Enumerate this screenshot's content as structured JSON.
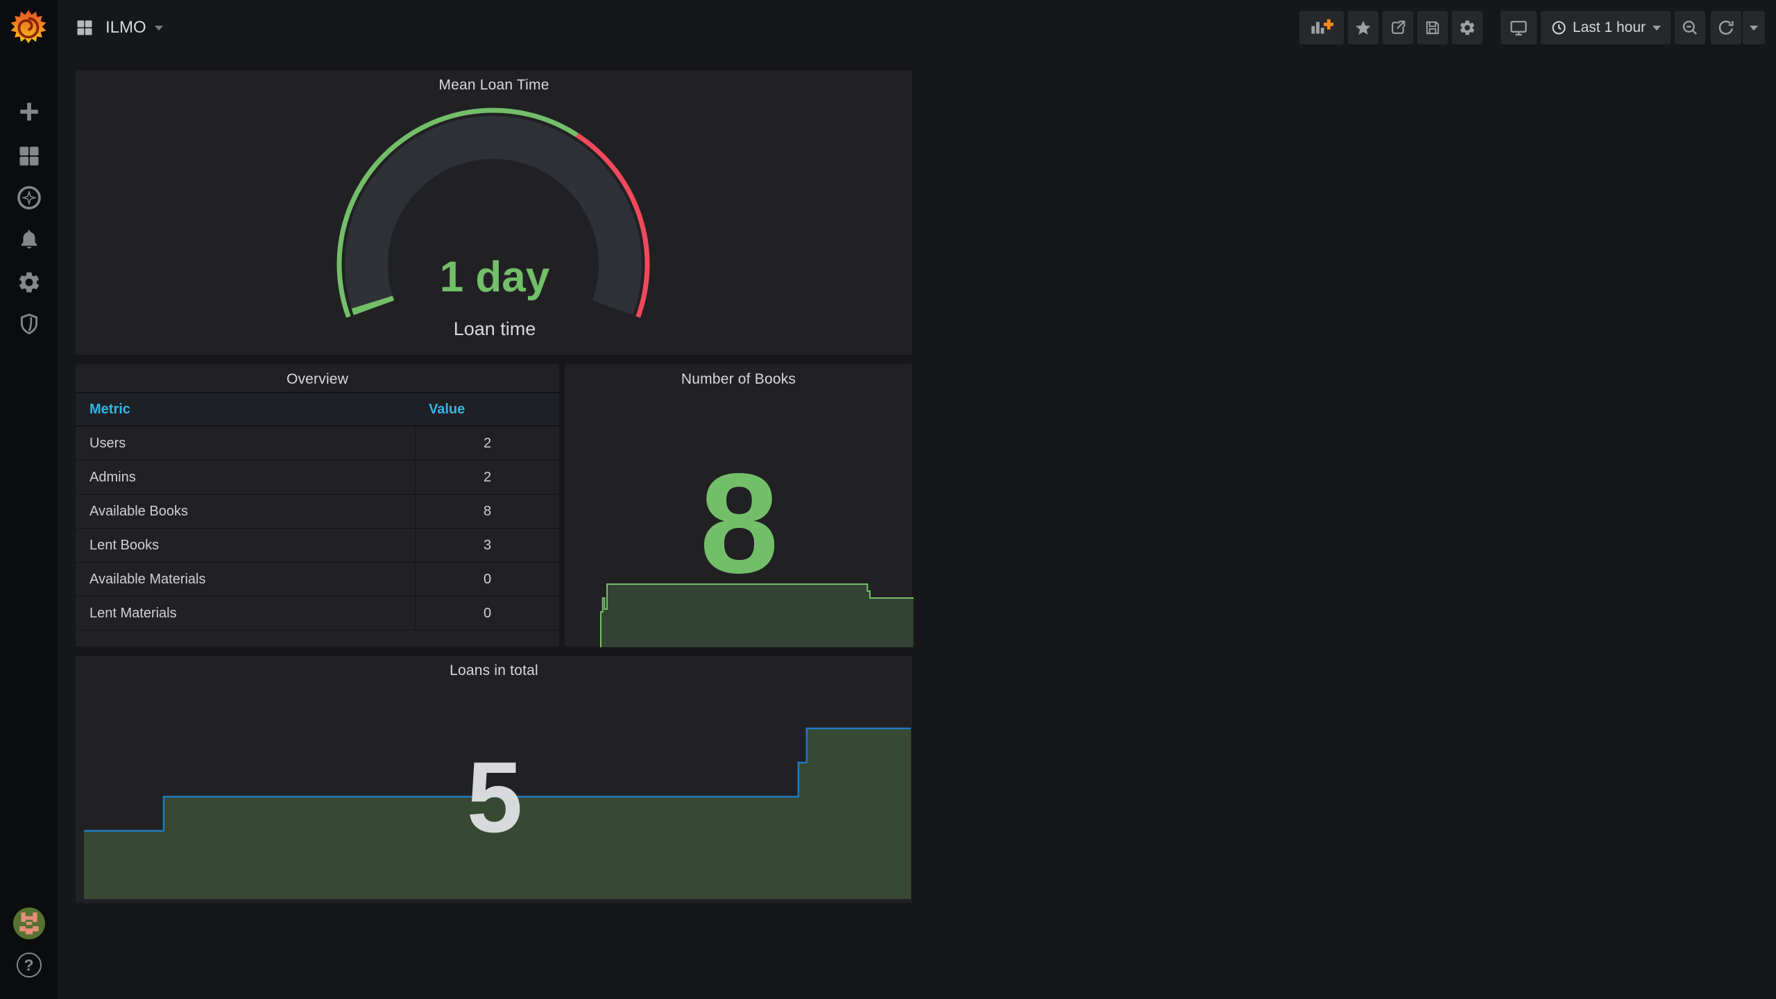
{
  "navbar": {
    "dashboard_title": "ILMO",
    "time_range": "Last 1 hour",
    "actions": [
      "add-panel",
      "star",
      "share",
      "save",
      "settings",
      "cycle-view",
      "time-picker",
      "zoom-out",
      "refresh",
      "refresh-interval"
    ]
  },
  "sidebar": {
    "items": [
      "create",
      "dashboards",
      "explore",
      "alerting",
      "configuration",
      "server-admin"
    ],
    "bottom": [
      "user-avatar",
      "help"
    ]
  },
  "colors": {
    "green": "#73bf69",
    "red": "#f2495c",
    "header_blue": "#33b5e5",
    "line_blue": "#1f78c1",
    "panel_bg": "#212124",
    "page_bg": "#161719"
  },
  "chart_data": [
    {
      "type": "gauge",
      "title": "Mean Loan Time",
      "value_text": "1 day",
      "label": "Loan time",
      "percent": 0.012,
      "threshold_split": 0.65,
      "colors": {
        "fill": "#73bf69",
        "ok": "#73bf69",
        "alert": "#f2495c",
        "track": "#2e3136"
      }
    },
    {
      "type": "table",
      "title": "Overview",
      "headers": [
        "Metric",
        "Value"
      ],
      "rows": [
        [
          "Users",
          "2"
        ],
        [
          "Admins",
          "2"
        ],
        [
          "Available Books",
          "8"
        ],
        [
          "Lent Books",
          "3"
        ],
        [
          "Available Materials",
          "0"
        ],
        [
          "Lent Materials",
          "0"
        ]
      ]
    },
    {
      "type": "area",
      "title": "Number of Books",
      "big_value": "8",
      "steps": [
        [
          0,
          6
        ],
        [
          0.006,
          7
        ],
        [
          0.012,
          6.2
        ],
        [
          0.02,
          8
        ],
        [
          0.845,
          8
        ],
        [
          0.852,
          7.5
        ],
        [
          0.86,
          7
        ],
        [
          1,
          7
        ]
      ],
      "vmin": 6,
      "vmax": 8,
      "line_color": "#73bf69",
      "fill_color": "rgba(115,191,105,0.22)"
    },
    {
      "type": "area",
      "title": "Loans in total",
      "big_value": "5",
      "steps": [
        [
          0,
          2
        ],
        [
          0.0965,
          3
        ],
        [
          0.864,
          4
        ],
        [
          0.874,
          5
        ],
        [
          1,
          5
        ]
      ],
      "vmin": 0,
      "vmax": 5,
      "line_color": "#1f78c1",
      "fill_color": "rgba(104,158,82,0.32)"
    }
  ]
}
